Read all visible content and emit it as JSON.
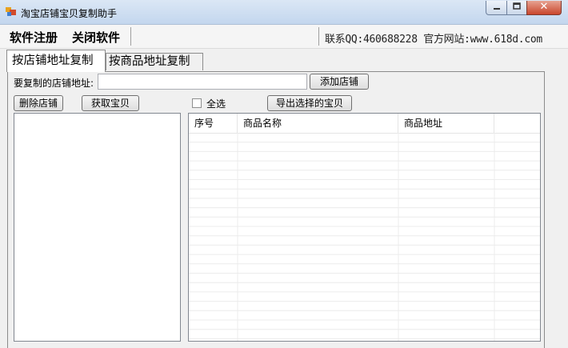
{
  "window": {
    "title": "淘宝店铺宝贝复制助手"
  },
  "menu": {
    "register": "软件注册",
    "close_app": "关闭软件",
    "contact": "联系QQ:460688228 官方网站:www.618d.com"
  },
  "tabs": [
    {
      "label": "按店铺地址复制",
      "active": true
    },
    {
      "label": "按商品地址复制",
      "active": false
    }
  ],
  "shop_form": {
    "address_label": "要复制的店铺地址:",
    "address_value": "",
    "add_button": "添加店铺",
    "delete_button": "删除店铺",
    "fetch_button": "获取宝贝"
  },
  "items_panel": {
    "select_all_label": "全选",
    "select_all_checked": false,
    "export_button": "导出选择的宝贝",
    "columns": [
      "序号",
      "商品名称",
      "商品地址",
      ""
    ],
    "rows": []
  }
}
